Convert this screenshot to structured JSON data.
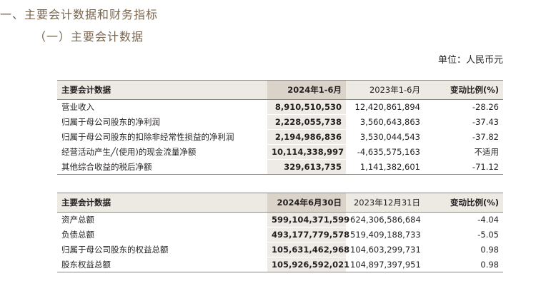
{
  "section_title": "一、主要会计数据和财务指标",
  "subsection_title": "（一）主要会计数据",
  "unit_label": "单位：人民币元",
  "table1": {
    "headers": [
      "主要会计数据",
      "2024年1-6月",
      "2023年1-6月",
      "变动比例(%)"
    ],
    "rows": [
      [
        "营业收入",
        "8,910,510,530",
        "12,420,861,894",
        "-28.26"
      ],
      [
        "归属于母公司股东的净利润",
        "2,228,055,738",
        "3,560,643,863",
        "-37.43"
      ],
      [
        "归属于母公司股东的扣除非经常性损益的净利润",
        "2,194,986,836",
        "3,530,044,543",
        "-37.82"
      ],
      [
        "经营活动产生╱(使用)的现金流量净额",
        "10,114,338,997",
        "-4,635,575,163",
        "不适用"
      ],
      [
        "其他综合收益的税后净额",
        "329,613,735",
        "1,141,382,601",
        "-71.12"
      ]
    ]
  },
  "table2": {
    "headers": [
      "主要会计数据",
      "2024年6月30日",
      "2023年12月31日",
      "变动比例(%)"
    ],
    "rows": [
      [
        "资产总额",
        "599,104,371,599",
        "624,306,586,684",
        "-4.04"
      ],
      [
        "负债总额",
        "493,177,779,578",
        "519,409,188,733",
        "-5.05"
      ],
      [
        "归属于母公司股东的权益总额",
        "105,631,462,968",
        "104,603,299,731",
        "0.98"
      ],
      [
        "股东权益总额",
        "105,926,592,021",
        "104,897,397,951",
        "0.98"
      ]
    ]
  }
}
